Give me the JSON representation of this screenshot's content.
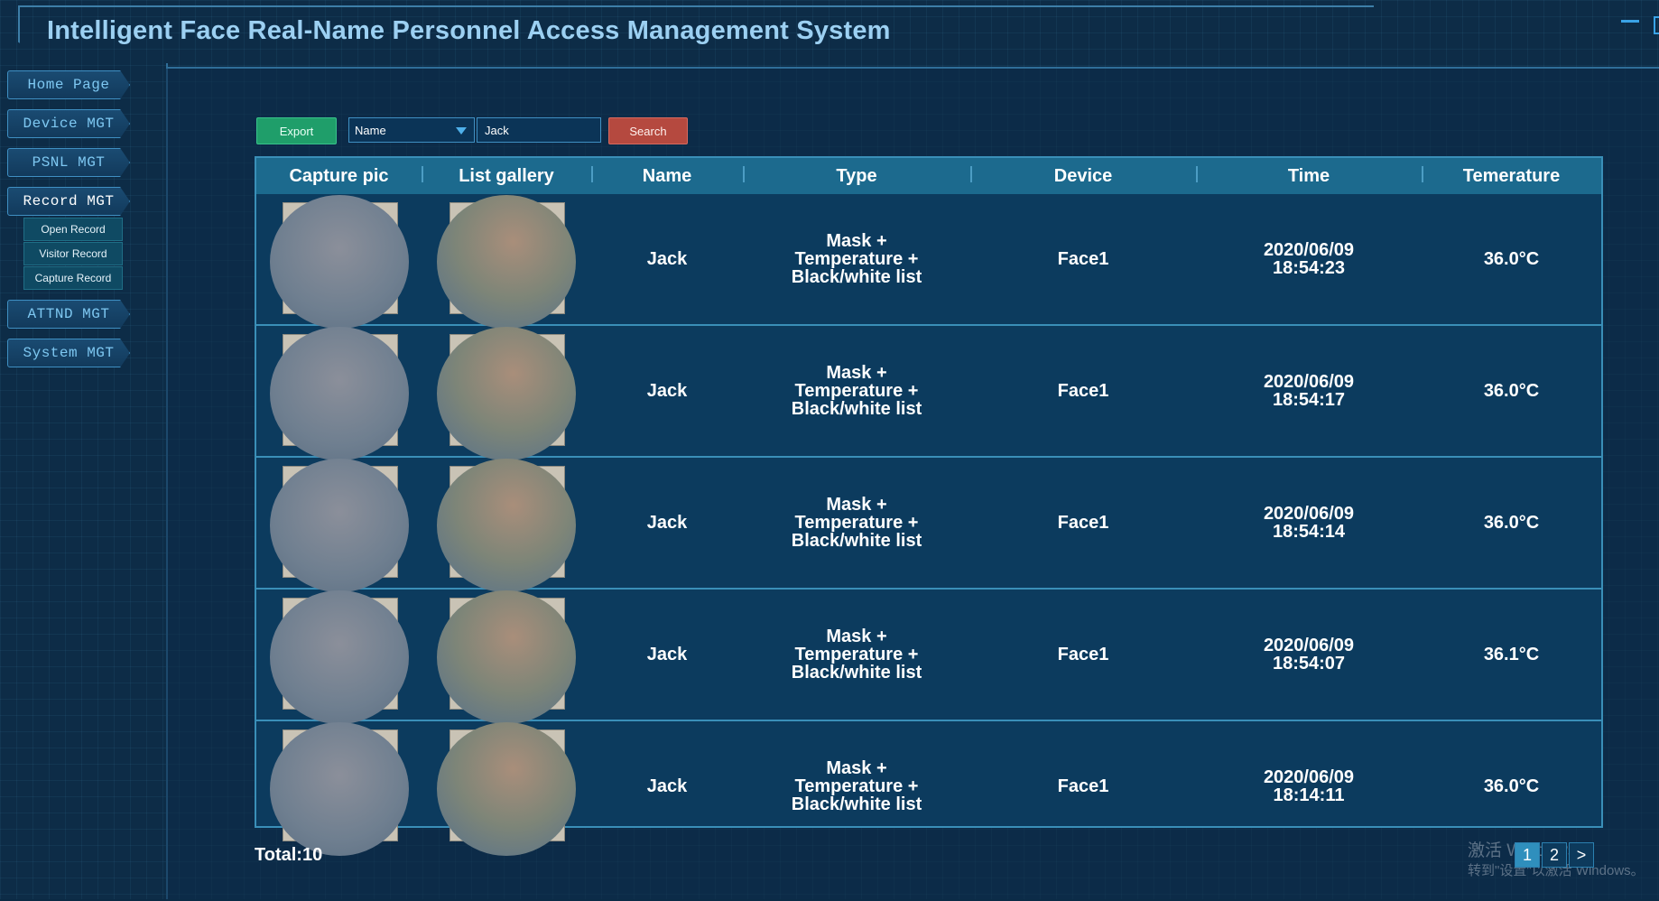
{
  "header": {
    "title": "Intelligent Face Real-Name Personnel Access Management System"
  },
  "sidebar": {
    "items": [
      {
        "label": "Home Page"
      },
      {
        "label": "Device MGT"
      },
      {
        "label": "PSNL MGT"
      },
      {
        "label": "Record MGT",
        "active": true
      },
      {
        "label": "ATTND MGT"
      },
      {
        "label": "System MGT"
      }
    ],
    "sub_items": [
      {
        "label": "Open Record"
      },
      {
        "label": "Visitor Record"
      },
      {
        "label": "Capture Record"
      }
    ]
  },
  "toolbar": {
    "export_label": "Export",
    "field_select": "Name",
    "search_value": "Jack",
    "search_label": "Search"
  },
  "table": {
    "columns": [
      "Capture pic",
      "List gallery",
      "Name",
      "Type",
      "Device",
      "Time",
      "Temerature"
    ],
    "rows": [
      {
        "name": "Jack",
        "type_lines": [
          "Mask +",
          "Temperature +",
          "Black/white list"
        ],
        "device": "Face1",
        "date": "2020/06/09",
        "time": "18:54:23",
        "temperature": "36.0°C"
      },
      {
        "name": "Jack",
        "type_lines": [
          "Mask +",
          "Temperature +",
          "Black/white list"
        ],
        "device": "Face1",
        "date": "2020/06/09",
        "time": "18:54:17",
        "temperature": "36.0°C"
      },
      {
        "name": "Jack",
        "type_lines": [
          "Mask +",
          "Temperature +",
          "Black/white list"
        ],
        "device": "Face1",
        "date": "2020/06/09",
        "time": "18:54:14",
        "temperature": "36.0°C"
      },
      {
        "name": "Jack",
        "type_lines": [
          "Mask +",
          "Temperature +",
          "Black/white list"
        ],
        "device": "Face1",
        "date": "2020/06/09",
        "time": "18:54:07",
        "temperature": "36.1°C"
      },
      {
        "name": "Jack",
        "type_lines": [
          "Mask +",
          "Temperature +",
          "Black/white list"
        ],
        "device": "Face1",
        "date": "2020/06/09",
        "time": "18:14:11",
        "temperature": "36.0°C"
      }
    ]
  },
  "footer": {
    "total": "Total:10",
    "pages": [
      "1",
      "2"
    ],
    "current_page": "1",
    "next_label": ">"
  },
  "os_watermark": {
    "line1": "激活 Windows",
    "line2": "转到\"设置\"以激活 Windows。"
  },
  "colors": {
    "accent": "#3aa3e6",
    "export": "#1f9e6a",
    "search": "#b5493f",
    "header_bg": "#1c6a8e"
  }
}
